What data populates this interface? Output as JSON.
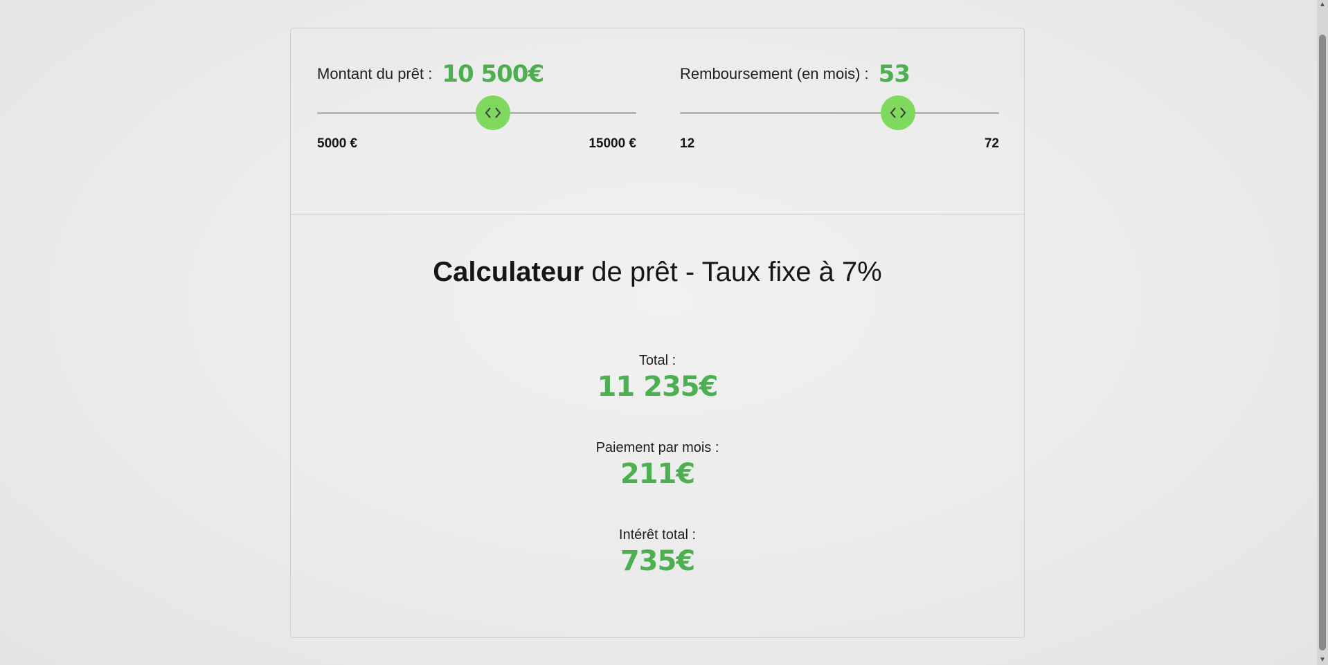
{
  "loan_slider": {
    "label": "Montant du prêt :",
    "value_display": "10 500€",
    "value": 10500,
    "min": 5000,
    "max": 15000,
    "min_label": "5000 €",
    "max_label": "15000 €",
    "thumb_icon": "chevron-left-right-icon"
  },
  "months_slider": {
    "label": "Remboursement (en mois) :",
    "value_display": "53",
    "value": 53,
    "min": 12,
    "max": 72,
    "min_label": "12",
    "max_label": "72",
    "thumb_icon": "chevron-left-right-icon"
  },
  "calculator": {
    "title_strong": "Calculateur",
    "title_rest": " de prêt - Taux fixe à 7%"
  },
  "results": {
    "total": {
      "label": "Total :",
      "value": "11 235€"
    },
    "monthly": {
      "label": "Paiement par mois :",
      "value": "211€"
    },
    "interest": {
      "label": "Intérêt total :",
      "value": "735€"
    }
  },
  "colors": {
    "accent_green": "#4caf50",
    "thumb_green": "#7ed95e",
    "background": "#ebebeb",
    "track": "#b5b5b5"
  }
}
